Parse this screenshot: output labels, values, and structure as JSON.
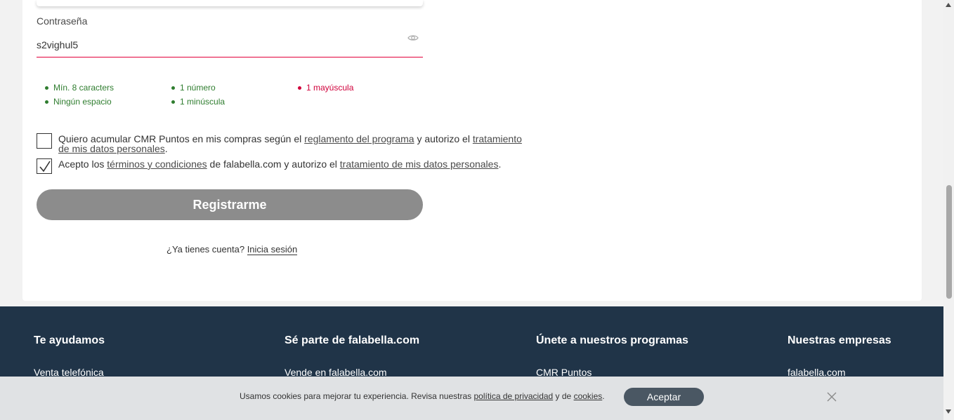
{
  "form": {
    "password_label": "Contraseña",
    "password_value": "s2vighul5",
    "rules": [
      {
        "text": "Mín. 8 caracters",
        "ok": true
      },
      {
        "text": "1 número",
        "ok": true
      },
      {
        "text": "1 mayúscula",
        "ok": false
      },
      {
        "text": "Ningún espacio",
        "ok": true
      },
      {
        "text": "1 minúscula",
        "ok": true
      }
    ],
    "cmr_consent": {
      "checked": false,
      "prefix": "Quiero acumular CMR Puntos en mis compras según el ",
      "link1": "reglamento del programa",
      "middle": "  y autorizo el ",
      "link2_line1": "tratamiento",
      "link2_line2": "de mis datos personales",
      "suffix": "."
    },
    "terms_consent": {
      "checked": true,
      "prefix": "Acepto los ",
      "link1": "términos y condiciones",
      "middle": " de falabella.com  y autorizo el ",
      "link2": "tratamiento de mis datos personales",
      "suffix": "."
    },
    "register_label": "Registrarme",
    "login_prompt": "¿Ya tienes cuenta?",
    "login_link": "Inicia sesión"
  },
  "footer": {
    "columns": [
      {
        "title": "Te ayudamos",
        "first_link": "Venta telefónica"
      },
      {
        "title": "Sé parte de falabella.com",
        "first_link": "Vende en falabella.com"
      },
      {
        "title": "Únete a nuestros programas",
        "first_link": "CMR Puntos"
      },
      {
        "title": "Nuestras empresas",
        "first_link": "falabella.com"
      }
    ]
  },
  "cookies": {
    "text_before": "Usamos cookies para mejorar tu experiencia. Revisa nuestras ",
    "privacy_link": "política de privacidad",
    "text_middle": " y de ",
    "cookies_link": "cookies",
    "text_after": ".",
    "accept_label": "Aceptar"
  },
  "colors": {
    "valid": "#2f7d2f",
    "invalid": "#d0003b",
    "footer_bg": "#203448",
    "button_disabled": "#8c8c8c"
  },
  "icons": {
    "eye": "eye-icon",
    "check": "checkmark-icon",
    "close": "close-icon"
  }
}
